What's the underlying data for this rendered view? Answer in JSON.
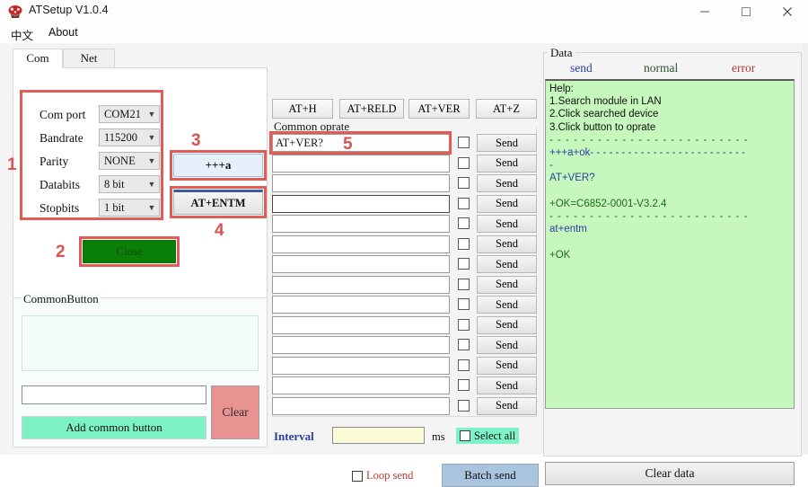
{
  "window": {
    "title": "ATSetup V1.0.4",
    "icon": "app-icon",
    "minimize": "—",
    "maximize": "□",
    "close": "×"
  },
  "menubar": {
    "items": [
      {
        "label": "中文"
      },
      {
        "label": "About"
      }
    ]
  },
  "tabs": [
    {
      "label": "Com",
      "active": true
    },
    {
      "label": "Net",
      "active": false
    }
  ],
  "serial": {
    "fields": [
      {
        "label": "Com port",
        "value": "COM21"
      },
      {
        "label": "Bandrate",
        "value": "115200"
      },
      {
        "label": "Parity",
        "value": "NONE"
      },
      {
        "label": "Databits",
        "value": "8 bit"
      },
      {
        "label": "Stopbits",
        "value": "1 bit"
      }
    ],
    "close_button": "Close",
    "plus_a_button": "+++a",
    "at_entm_button": "AT+ENTM"
  },
  "annotations": [
    {
      "id": "1",
      "label": "1"
    },
    {
      "id": "2",
      "label": "2"
    },
    {
      "id": "3",
      "label": "3"
    },
    {
      "id": "4",
      "label": "4"
    },
    {
      "id": "5",
      "label": "5"
    }
  ],
  "common_button": {
    "title": "CommonButton",
    "list_items": [],
    "name_input_value": "",
    "add_button": "Add common button",
    "clear_button": "Clear"
  },
  "quick_commands": [
    {
      "label": "AT+H"
    },
    {
      "label": "AT+RELD"
    },
    {
      "label": "AT+VER"
    },
    {
      "label": "AT+Z"
    }
  ],
  "common_operate": {
    "title": "Common oprate",
    "send_label": "Send",
    "rows": [
      {
        "value": "AT+VER?",
        "checked": false
      },
      {
        "value": "",
        "checked": false
      },
      {
        "value": "",
        "checked": false
      },
      {
        "value": "",
        "checked": false
      },
      {
        "value": "",
        "checked": false
      },
      {
        "value": "",
        "checked": false
      },
      {
        "value": "",
        "checked": false
      },
      {
        "value": "",
        "checked": false
      },
      {
        "value": "",
        "checked": false
      },
      {
        "value": "",
        "checked": false
      },
      {
        "value": "",
        "checked": false
      },
      {
        "value": "",
        "checked": false
      },
      {
        "value": "",
        "checked": false
      },
      {
        "value": "",
        "checked": false
      }
    ]
  },
  "send_controls": {
    "interval_label": "Interval",
    "interval_value": "",
    "interval_unit": "ms",
    "select_all_label": "Select all",
    "select_all_checked": false,
    "loop_send_label": "Loop send",
    "loop_send_checked": false,
    "batch_send_label": "Batch send"
  },
  "data_panel": {
    "title": "Data",
    "legend": [
      {
        "label": "send",
        "color": "#2b3fa0"
      },
      {
        "label": "normal",
        "color": "#2f4f2f"
      },
      {
        "label": "error",
        "color": "#b03a2e"
      }
    ],
    "clear_button": "Clear data",
    "background_color": "#c6f7bd",
    "console_lines": [
      {
        "text": "Help:",
        "kind": "help"
      },
      {
        "text": "1.Search module in LAN",
        "kind": "help"
      },
      {
        "text": "2.Click searched device",
        "kind": "help"
      },
      {
        "text": "3.Click button to oprate",
        "kind": "help"
      },
      {
        "text": "- - - - - - - - - - - - - - - - - - - - - - - - -",
        "kind": "sep"
      },
      {
        "text": "+++a+ok- - - - - - - - - - - - - - - - - - - - - - - - -",
        "kind": "send"
      },
      {
        "text": "-",
        "kind": "send"
      },
      {
        "text": "AT+VER?",
        "kind": "send"
      },
      {
        "text": "",
        "kind": "blank"
      },
      {
        "text": "+OK=C6852-0001-V3.2.4",
        "kind": "normal"
      },
      {
        "text": "- - - - - - - - - - - - - - - - - - - - - - - - -",
        "kind": "sep"
      },
      {
        "text": "at+entm",
        "kind": "send"
      },
      {
        "text": "",
        "kind": "blank"
      },
      {
        "text": "+OK",
        "kind": "normal"
      }
    ]
  },
  "colors": {
    "accent_green": "#0a8008",
    "annotation_red": "#e35b56",
    "console_bg": "#c6f7bd",
    "add_button_green": "#7df2c6",
    "clear_button_red": "#e99292",
    "batch_send_blue": "#a9c4df"
  }
}
